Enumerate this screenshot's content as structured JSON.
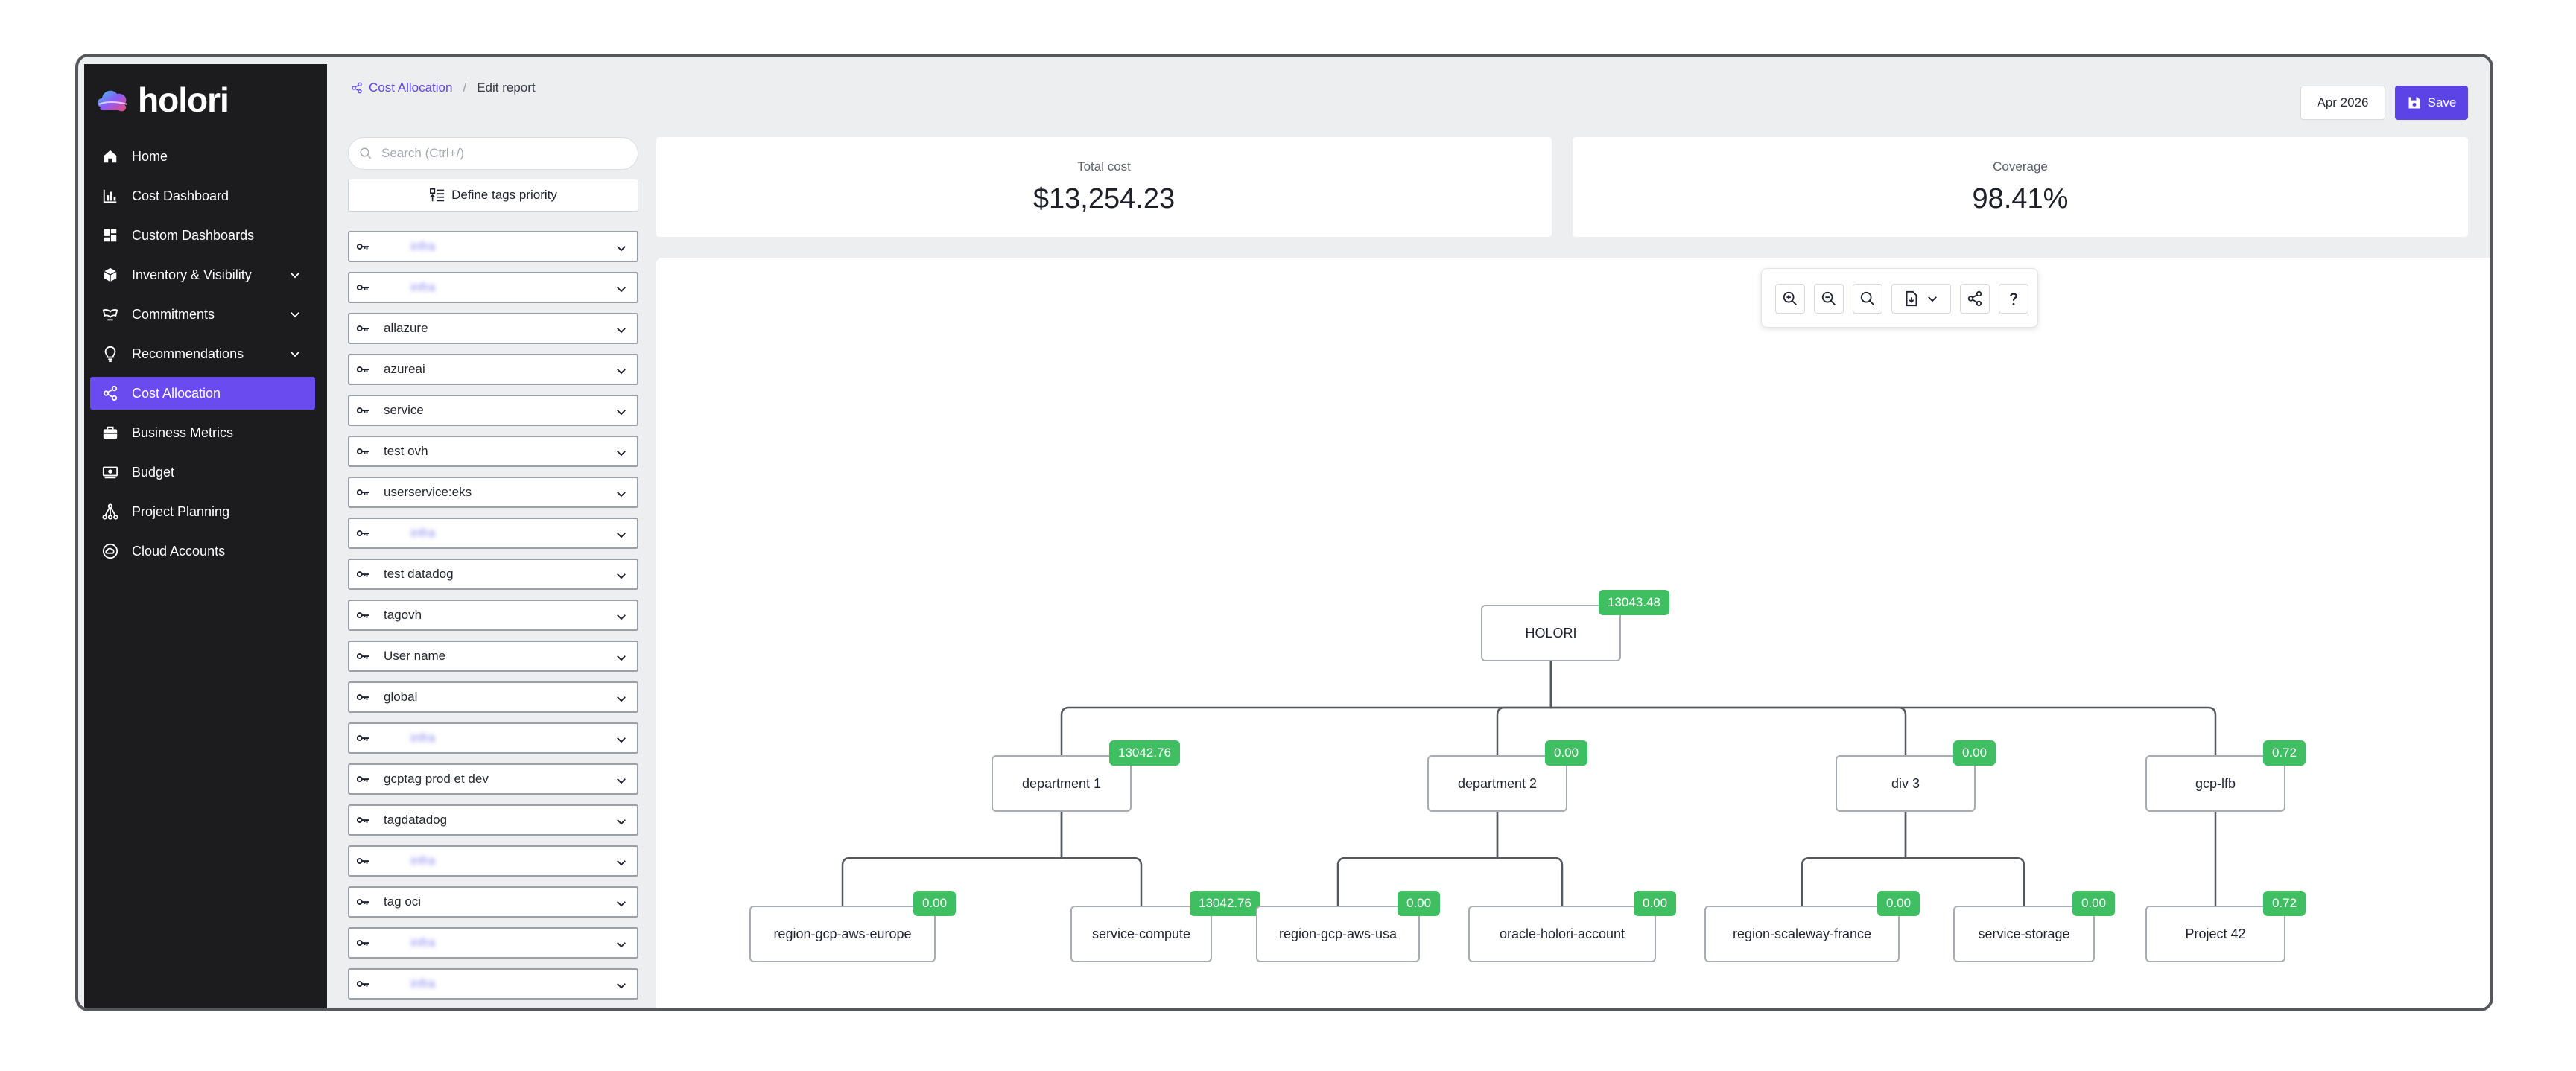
{
  "app": {
    "logo_text": "holori"
  },
  "sidebar": {
    "items": [
      {
        "label": "Home",
        "icon": "home-icon",
        "active": false,
        "expandable": false
      },
      {
        "label": "Cost Dashboard",
        "icon": "bar-chart-icon",
        "active": false,
        "expandable": false
      },
      {
        "label": "Custom Dashboards",
        "icon": "dashboard-grid-icon",
        "active": false,
        "expandable": false
      },
      {
        "label": "Inventory & Visibility",
        "icon": "cube-icon",
        "active": false,
        "expandable": true
      },
      {
        "label": "Commitments",
        "icon": "handshake-icon",
        "active": false,
        "expandable": true
      },
      {
        "label": "Recommendations",
        "icon": "lightbulb-icon",
        "active": false,
        "expandable": true
      },
      {
        "label": "Cost Allocation",
        "icon": "share-icon",
        "active": true,
        "expandable": false
      },
      {
        "label": "Business Metrics",
        "icon": "briefcase-icon",
        "active": false,
        "expandable": false
      },
      {
        "label": "Budget",
        "icon": "money-icon",
        "active": false,
        "expandable": false
      },
      {
        "label": "Project Planning",
        "icon": "hierarchy-icon",
        "active": false,
        "expandable": false
      },
      {
        "label": "Cloud Accounts",
        "icon": "cloud-circle-icon",
        "active": false,
        "expandable": false
      }
    ]
  },
  "breadcrumb": {
    "parent": "Cost Allocation",
    "current": "Edit report"
  },
  "header": {
    "date_label": "Apr 2026",
    "save_label": "Save"
  },
  "search": {
    "placeholder": "Search (Ctrl+/)"
  },
  "define_tags_label": "Define tags priority",
  "tags": [
    {
      "label": "infra",
      "blurred": true
    },
    {
      "label": "infra",
      "blurred": true
    },
    {
      "label": "allazure",
      "blurred": false
    },
    {
      "label": "azureai",
      "blurred": false
    },
    {
      "label": "service",
      "blurred": false
    },
    {
      "label": "test ovh",
      "blurred": false
    },
    {
      "label": "userservice:eks",
      "blurred": false
    },
    {
      "label": "infra",
      "blurred": true
    },
    {
      "label": "test datadog",
      "blurred": false
    },
    {
      "label": "tagovh",
      "blurred": false
    },
    {
      "label": "User name",
      "blurred": false
    },
    {
      "label": "global",
      "blurred": false
    },
    {
      "label": "infra",
      "blurred": true
    },
    {
      "label": "gcptag prod et dev",
      "blurred": false
    },
    {
      "label": "tagdatadog",
      "blurred": false
    },
    {
      "label": "infra",
      "blurred": true
    },
    {
      "label": "tag oci",
      "blurred": false
    },
    {
      "label": "infra",
      "blurred": true
    },
    {
      "label": "infra",
      "blurred": true
    }
  ],
  "summary": {
    "total_cost_label": "Total cost",
    "total_cost_value": "$13,254.23",
    "coverage_label": "Coverage",
    "coverage_value": "98.41%"
  },
  "toolbar": [
    "zoom-in-icon",
    "zoom-out-icon",
    "zoom-reset-icon",
    "export-file-icon",
    "share-icon",
    "help-icon"
  ],
  "tree": {
    "root": {
      "label": "HOLORI",
      "value": "13043.48"
    },
    "children": [
      {
        "label": "department 1",
        "value": "13042.76",
        "children": [
          {
            "label": "region-gcp-aws-europe",
            "value": "0.00"
          },
          {
            "label": "service-compute",
            "value": "13042.76"
          }
        ]
      },
      {
        "label": "department 2",
        "value": "0.00",
        "children": [
          {
            "label": "region-gcp-aws-usa",
            "value": "0.00"
          },
          {
            "label": "oracle-holori-account",
            "value": "0.00"
          }
        ]
      },
      {
        "label": "div 3",
        "value": "0.00",
        "children": [
          {
            "label": "region-scaleway-france",
            "value": "0.00"
          },
          {
            "label": "service-storage",
            "value": "0.00"
          }
        ]
      },
      {
        "label": "gcp-lfb",
        "value": "0.72",
        "children": [
          {
            "label": "Project 42",
            "value": "0.72"
          }
        ]
      }
    ]
  },
  "colors": {
    "accent": "#5b43e6",
    "active_nav": "#6a4bf0",
    "badge": "#3fbf62",
    "sidebar_bg": "#1c1c1e"
  }
}
